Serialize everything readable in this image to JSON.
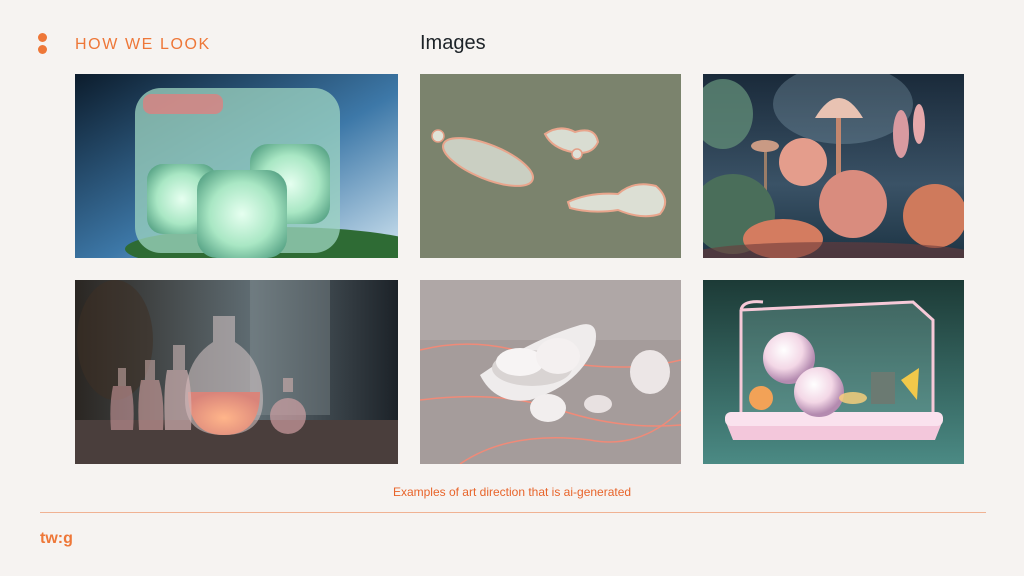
{
  "header": {
    "section_label": "HOW WE LOOK",
    "title": "Images"
  },
  "gallery": {
    "caption": "Examples of art direction that is ai-generated",
    "images": [
      {
        "subject": "translucent mint gel cubes"
      },
      {
        "subject": "glass droplets on sage background"
      },
      {
        "subject": "coral and mushroom fantasy garden"
      },
      {
        "subject": "glass bottles with peach liquid"
      },
      {
        "subject": "white pebbles with glowing lines"
      },
      {
        "subject": "glass terrarium box with spheres"
      }
    ]
  },
  "footer": {
    "brand": "tw:g"
  },
  "colors": {
    "background": "#f6f3f1",
    "accent": "#ee7738",
    "title": "#1d2328",
    "divider": "#f0b293"
  }
}
